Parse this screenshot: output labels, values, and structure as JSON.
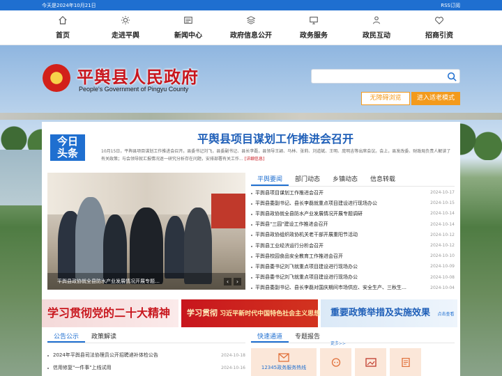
{
  "topbar": {
    "date": "今天是2024年10月21日",
    "rss": "RSS订阅"
  },
  "nav": [
    {
      "label": "首页",
      "icon": "home-icon"
    },
    {
      "label": "走进平舆",
      "icon": "sun-icon"
    },
    {
      "label": "新闻中心",
      "icon": "news-icon"
    },
    {
      "label": "政府信息公开",
      "icon": "layers-icon"
    },
    {
      "label": "政务服务",
      "icon": "monitor-icon"
    },
    {
      "label": "政民互动",
      "icon": "people-icon"
    },
    {
      "label": "招商引资",
      "icon": "heart-icon"
    }
  ],
  "site": {
    "title": "平舆县人民政府",
    "subtitle": "People's Government of Pingyu County"
  },
  "search": {
    "placeholder": ""
  },
  "buttons": {
    "accessible": "无障碍浏览",
    "elder": "进入适老模式"
  },
  "today": {
    "line1": "今日",
    "line2": "头条"
  },
  "headline": {
    "title": "平舆县项目谋划工作推进会召开",
    "summary": "10月15日，平舆县项目谋划工作推进会召开。县委书记刘飞，县委副书记、县长李磊，县领导王颖、马林、张莉、刘道斌、王明、庞明吉等出席会议。会上，县发改委、财政局负责人解读了有关政策；与会领导就汇报情况逐一研究分析存在问题，安排部署有关工作...",
    "more": "[详细信息]"
  },
  "photo": {
    "caption": "平舆县政协就全县防水产业发展情况开展专题…"
  },
  "news_tabs": [
    "平舆要闻",
    "部门动态",
    "乡镇动态",
    "信息转载"
  ],
  "news": [
    {
      "title": "平舆县项目谋划工作推进会召开",
      "date": "2024-10-17"
    },
    {
      "title": "平舆县委副书记、县长李磊就重点项目建设进行现场办公",
      "date": "2024-10-15"
    },
    {
      "title": "平舆县政协就全县防水产业发展情况开展专题调研",
      "date": "2024-10-14"
    },
    {
      "title": "平舆县\"三园\"建设工作推进会召开",
      "date": "2024-10-14"
    },
    {
      "title": "平舆县政协组织政协机关老干部开展重阳节活动",
      "date": "2024-10-12"
    },
    {
      "title": "平舆县工业经济运行分析会召开",
      "date": "2024-10-12"
    },
    {
      "title": "平舆县校园食品安全教育工作推进会召开",
      "date": "2024-10-10"
    },
    {
      "title": "平舆县委书记刘飞就重点项目建设进行现场办公",
      "date": "2024-10-09"
    },
    {
      "title": "平舆县委书记刘飞就重点项目建设进行现场办公",
      "date": "2024-10-08"
    },
    {
      "title": "平舆县委副书记、县长李磊对国庆期间市场供应、安全生产、三秋生…",
      "date": "2024-10-04"
    }
  ],
  "banners": {
    "b1": "学习贯彻党的二十大精神",
    "b2_big": "学习贯彻",
    "b2_small": "习近平新时代中国特色社会主义思想",
    "b3": "重要政策举措及实施效果",
    "b3_more": "点击查看更多>>"
  },
  "notice_tabs": [
    "公告公示",
    "政策解读"
  ],
  "notices": [
    {
      "title": "2024年平舆县司法协理员公开招聘递补体检公告",
      "date": "2024-10-18"
    },
    {
      "title": "信用修复\"一件事\"上线试用",
      "date": "2024-10-16"
    }
  ],
  "service_tabs": [
    "快速通道",
    "专题报告"
  ],
  "quick": [
    {
      "label": "12345政务服务热线",
      "icon": "mail-icon"
    },
    {
      "label": "",
      "icon": "chat-icon"
    },
    {
      "label": "",
      "icon": "image-icon"
    },
    {
      "label": "",
      "icon": "document-icon"
    }
  ],
  "colors": {
    "primary": "#1f6fd0",
    "red": "#c8161d",
    "orange": "#f39a1c"
  }
}
